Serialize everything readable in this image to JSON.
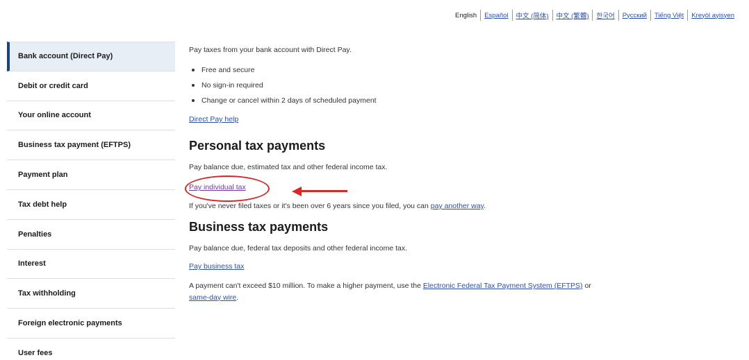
{
  "languages": [
    {
      "label": "English",
      "active": true
    },
    {
      "label": "Español",
      "active": false
    },
    {
      "label": "中文 (简体)",
      "active": false
    },
    {
      "label": "中文 (繁體)",
      "active": false
    },
    {
      "label": "한국어",
      "active": false
    },
    {
      "label": "Pусский",
      "active": false
    },
    {
      "label": "Tiếng Việt",
      "active": false
    },
    {
      "label": "Kreyòl ayisyen",
      "active": false
    }
  ],
  "sidebar": {
    "items": [
      {
        "label": "Bank account (Direct Pay)",
        "active": true
      },
      {
        "label": "Debit or credit card"
      },
      {
        "label": "Your online account"
      },
      {
        "label": "Business tax payment (EFTPS)"
      },
      {
        "label": "Payment plan"
      },
      {
        "label": "Tax debt help"
      },
      {
        "label": "Penalties"
      },
      {
        "label": "Interest"
      },
      {
        "label": "Tax withholding"
      },
      {
        "label": "Foreign electronic payments"
      },
      {
        "label": "User fees"
      }
    ]
  },
  "main": {
    "intro": "Pay taxes from your bank account with Direct Pay.",
    "bullets": [
      "Free and secure",
      "No sign-in required",
      "Change or cancel within 2 days of scheduled payment"
    ],
    "help_link": "Direct Pay help",
    "personal": {
      "heading": "Personal tax payments",
      "description": "Pay balance due, estimated tax and other federal income tax.",
      "pay_link": "Pay individual tax",
      "note_prefix": "If you've never filed taxes or it's been over 6 years since you filed, you can ",
      "note_link": "pay another way",
      "note_suffix": "."
    },
    "business": {
      "heading": "Business tax payments",
      "description": "Pay balance due, federal tax deposits and other federal income tax.",
      "pay_link": "Pay business tax",
      "note_prefix": "A payment can't exceed $10 million. To make a higher payment, use the ",
      "note_link1": "Electronic Federal Tax Payment System (EFTPS)",
      "note_middle": " or ",
      "note_link2": "same-day wire",
      "note_suffix": "."
    }
  },
  "colors": {
    "link": "#2b4fb0",
    "visited_link": "#6d3aa3",
    "annotation": "#d62828",
    "active_nav_bg": "#e7eef6"
  }
}
